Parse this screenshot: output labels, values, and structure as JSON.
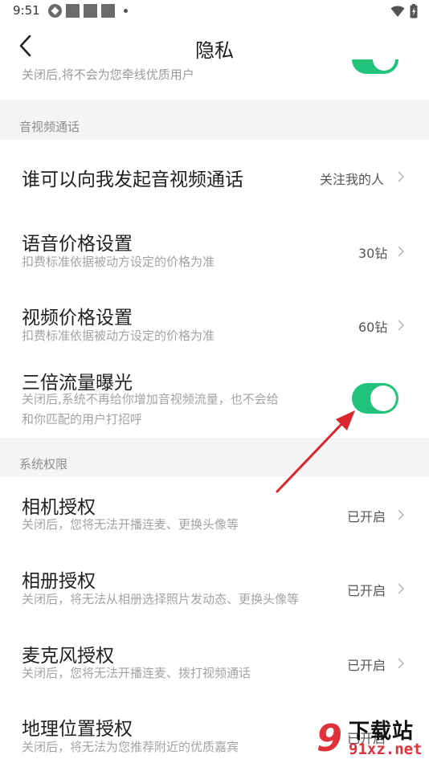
{
  "status_bar": {
    "time": "9:51"
  },
  "header": {
    "title": "隐私"
  },
  "partial_row": {
    "text": "关闭后,将不会为您牵线优质用户",
    "toggle_on": true
  },
  "sections": {
    "av_call": {
      "header": "音视频通话"
    },
    "system": {
      "header": "系统权限"
    }
  },
  "rows": {
    "who_can_call": {
      "title": "谁可以向我发起音视频通话",
      "value": "关注我的人"
    },
    "voice_price": {
      "title": "语音价格设置",
      "desc": "扣费标准依据被动方设定的价格为准",
      "value": "30钻"
    },
    "video_price": {
      "title": "视频价格设置",
      "desc": "扣费标准依据被动方设定的价格为准",
      "value": "60钻"
    },
    "triple_exposure": {
      "title": "三倍流量曝光",
      "desc_line1": "关闭后,系统不再给你增加音视频流量，也不会给",
      "desc_line2": "和你匹配的用户打招呼",
      "toggle_on": true
    },
    "camera": {
      "title": "相机授权",
      "desc": "关闭后，您将无法开播连麦、更换头像等",
      "value": "已开启"
    },
    "album": {
      "title": "相册授权",
      "desc": "关闭后，将无法从相册选择照片发动态、更换头像等",
      "value": "已开启"
    },
    "microphone": {
      "title": "麦克风授权",
      "desc": "关闭后，您将无法开播连麦、拨打视频通话",
      "value": "已开启"
    },
    "location": {
      "title": "地理位置授权",
      "desc": "关闭后，将无法为您推荐附近的优质嘉宾",
      "value": "已开启"
    }
  },
  "colors": {
    "toggle_on": "#21c27a",
    "annotation_arrow": "#d8262c",
    "section_bg": "#f4f4f4"
  },
  "watermark": {
    "logo_number": "9",
    "title": "下载站",
    "domain": "91xz.net"
  }
}
